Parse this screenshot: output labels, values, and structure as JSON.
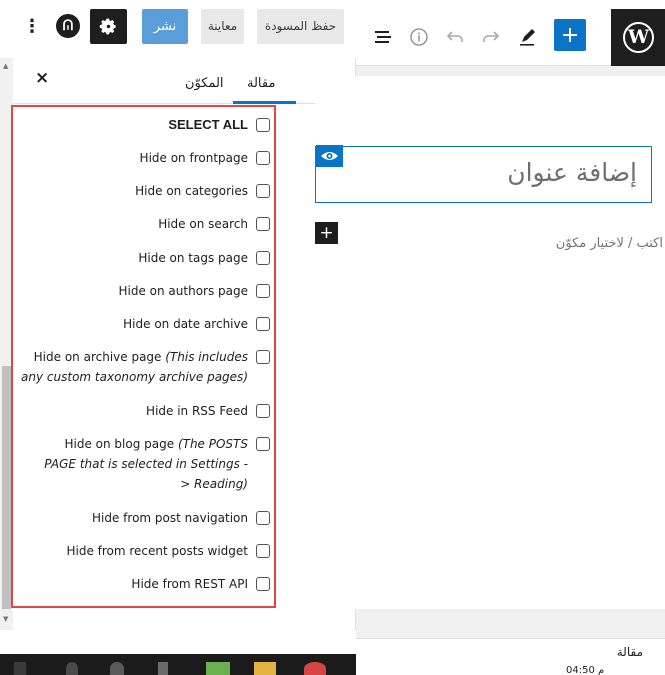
{
  "topbar": {
    "publish_label": "نشر",
    "preview_label": "معاينة",
    "save_draft_label": "حفظ المسودة",
    "logo_letter": "ᕬ",
    "wp_letter": "W",
    "accent_color": "#0a74c6"
  },
  "sidebar": {
    "tab_post": "مقالة",
    "tab_block": "المكوّن",
    "close_label": "×",
    "options": [
      {
        "label": "SELECT ALL",
        "note": "",
        "checked": false
      },
      {
        "label": "Hide on frontpage",
        "note": "",
        "checked": false
      },
      {
        "label": "Hide on categories",
        "note": "",
        "checked": false
      },
      {
        "label": "Hide on search",
        "note": "",
        "checked": false
      },
      {
        "label": "Hide on tags page",
        "note": "",
        "checked": false
      },
      {
        "label": "Hide on authors page",
        "note": "",
        "checked": false
      },
      {
        "label": "Hide on date archive",
        "note": "",
        "checked": false
      },
      {
        "label": "Hide on archive page",
        "note": "(This includes any custom taxonomy archive pages)",
        "checked": false
      },
      {
        "label": "Hide in RSS Feed",
        "note": "",
        "checked": false
      },
      {
        "label": "Hide on blog page",
        "note": "(The POSTS PAGE that is selected in Settings -> Reading)",
        "checked": false
      },
      {
        "label": "Hide from post navigation",
        "note": "",
        "checked": false
      },
      {
        "label": "Hide from recent posts widget",
        "note": "",
        "checked": false
      },
      {
        "label": "Hide from REST API",
        "note": "",
        "checked": false
      }
    ]
  },
  "editor": {
    "title_placeholder": "إضافة عنوان",
    "body_placeholder": "اكتب / لاختيار مكوّن",
    "add_block_label": "+"
  },
  "footer": {
    "breadcrumb": "مقالة",
    "clock": "04:50 م"
  }
}
